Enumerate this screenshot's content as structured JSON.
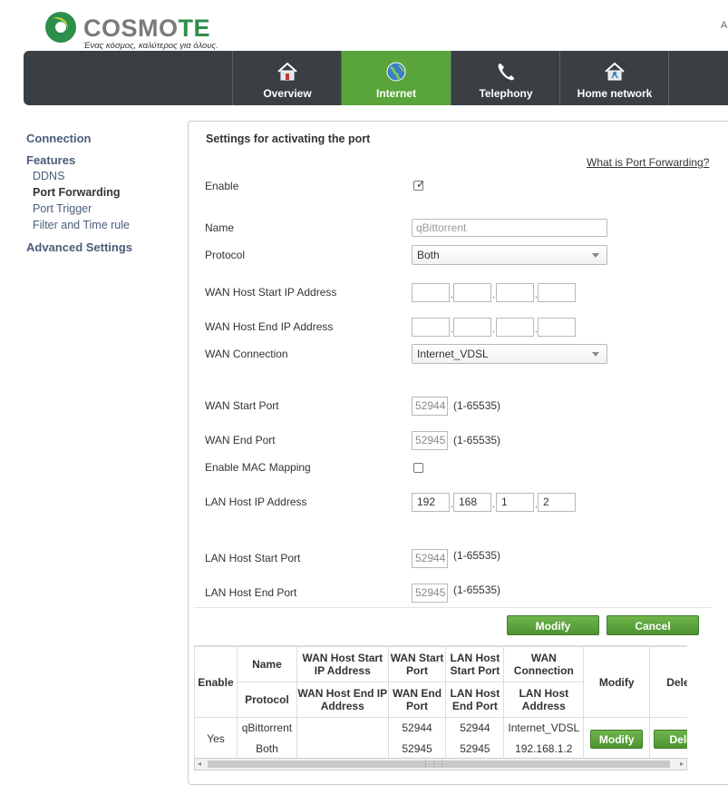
{
  "header": {
    "brand": "COSMOTE",
    "tagline": "Ένας κόσμος, καλύτερος για όλους.",
    "corner_text": "A",
    "nav": [
      {
        "label": "Overview",
        "icon": "house-icon"
      },
      {
        "label": "Internet",
        "icon": "globe-icon",
        "active": true
      },
      {
        "label": "Telephony",
        "icon": "phone-icon"
      },
      {
        "label": "Home network",
        "icon": "network-house-icon"
      }
    ],
    "colors": {
      "nav_bg": "#3a3f44",
      "active_tab": "#5aa53b",
      "brand_green": "#2d8f4a"
    }
  },
  "sidebar": {
    "connection": "Connection",
    "features": "Features",
    "items": [
      "DDNS",
      "Port Forwarding",
      "Port Trigger",
      "Filter and Time rule"
    ],
    "current": "Port Forwarding",
    "advanced": "Advanced Settings"
  },
  "form": {
    "title": "Settings for activating the port",
    "help_link": "What is Port Forwarding?",
    "enable_label": "Enable",
    "enable_checked": true,
    "name_label": "Name",
    "name_value": "qBittorrent",
    "protocol_label": "Protocol",
    "protocol_value": "Both",
    "wan_start_ip_label": "WAN Host Start IP Address",
    "wan_end_ip_label": "WAN Host End IP Address",
    "wan_conn_label": "WAN Connection",
    "wan_conn_value": "Internet_VDSL",
    "wan_start_port_label": "WAN Start Port",
    "wan_start_port": "52944",
    "wan_end_port_label": "WAN End Port",
    "wan_end_port": "52945",
    "port_range": "(1-65535)",
    "mac_label": "Enable MAC Mapping",
    "lan_ip_label": "LAN Host IP Address",
    "lan_ip": [
      "192",
      "168",
      "1",
      "2"
    ],
    "lan_start_port_label": "LAN Host Start Port",
    "lan_start_port": "52944",
    "lan_end_port_label": "LAN Host End Port",
    "lan_end_port": "52945",
    "modify": "Modify",
    "cancel": "Cancel"
  },
  "table": {
    "h_enable": "Enable",
    "h_name": "Name",
    "h_protocol": "Protocol",
    "h_wan_start_ip": "WAN Host Start IP Address",
    "h_wan_end_ip": "WAN Host End IP Address",
    "h_wan_start_port": "WAN Start Port",
    "h_wan_end_port": "WAN End Port",
    "h_lan_start_port": "LAN Host Start Port",
    "h_lan_end_port": "LAN Host End Port",
    "h_wan_conn": "WAN Connection",
    "h_lan_addr": "LAN Host Address",
    "h_modify": "Modify",
    "h_delete": "Dele",
    "row": {
      "enable": "Yes",
      "name": "qBittorrent",
      "protocol": "Both",
      "wan_start_port": "52944",
      "wan_end_port": "52945",
      "lan_start_port": "52944",
      "lan_end_port": "52945",
      "wan_conn": "Internet_VDSL",
      "lan_addr": "192.168.1.2",
      "modify": "Modify",
      "delete": "Dele"
    }
  }
}
